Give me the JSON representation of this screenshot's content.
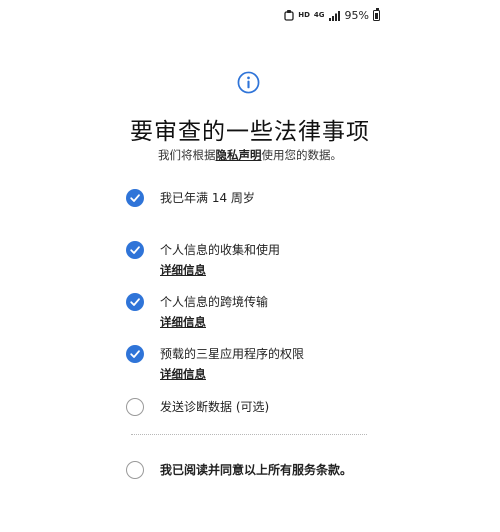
{
  "status_bar": {
    "battery_percent": "95%",
    "hd_label": "HD",
    "network_label": "4G"
  },
  "header": {
    "title": "要审查的一些法律事项",
    "subtitle_prefix": "我们将根据",
    "subtitle_link": "隐私声明",
    "subtitle_suffix": "使用您的数据。"
  },
  "items": [
    {
      "label": "我已年满 14 周岁",
      "checked": true
    },
    {
      "label": "个人信息的收集和使用",
      "link": "详细信息",
      "checked": true
    },
    {
      "label": "个人信息的跨境传输",
      "link": "详细信息",
      "checked": true
    },
    {
      "label": "预载的三星应用程序的权限",
      "link": "详细信息",
      "checked": true
    },
    {
      "label": "发送诊断数据 (可选)",
      "checked": false
    }
  ],
  "agree_all": {
    "label": "我已阅读并同意以上所有服务条款。",
    "checked": false
  },
  "colors": {
    "accent": "#2f74d8",
    "unchecked_border": "#9a9a9a"
  },
  "icons": {
    "header": "info-icon",
    "checked": "check-icon"
  }
}
